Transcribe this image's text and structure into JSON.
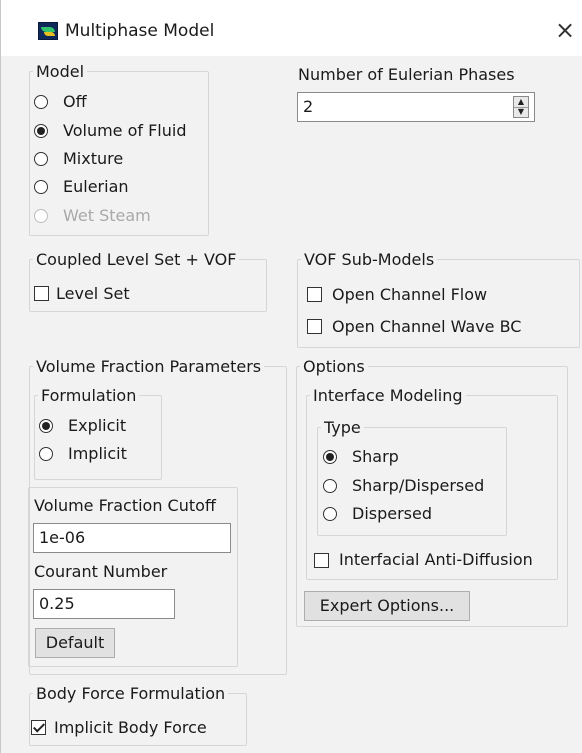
{
  "window": {
    "title": "Multiphase Model",
    "close_glyph": "×",
    "icon": "fluent-app-icon"
  },
  "model": {
    "legend": "Model",
    "options": [
      {
        "label": "Off",
        "selected": false,
        "enabled": true
      },
      {
        "label": "Volume of Fluid",
        "selected": true,
        "enabled": true
      },
      {
        "label": "Mixture",
        "selected": false,
        "enabled": true
      },
      {
        "label": "Eulerian",
        "selected": false,
        "enabled": true
      },
      {
        "label": "Wet Steam",
        "selected": false,
        "enabled": false
      }
    ]
  },
  "eulerian_phases": {
    "label": "Number of Eulerian Phases",
    "value": "2"
  },
  "coupled": {
    "legend": "Coupled Level Set + VOF",
    "level_set": {
      "label": "Level Set",
      "checked": false
    }
  },
  "vof_submodels": {
    "legend": "VOF Sub-Models",
    "open_channel_flow": {
      "label": "Open Channel Flow",
      "checked": false
    },
    "open_channel_wave_bc": {
      "label": "Open Channel Wave BC",
      "checked": false
    }
  },
  "vf_params": {
    "legend": "Volume Fraction Parameters",
    "formulation": {
      "legend": "Formulation",
      "explicit": {
        "label": "Explicit",
        "selected": true
      },
      "implicit": {
        "label": "Implicit",
        "selected": false
      }
    },
    "cutoff": {
      "label": "Volume Fraction Cutoff",
      "value": "1e-06"
    },
    "courant": {
      "label": "Courant Number",
      "value": "0.25"
    },
    "default_button": "Default"
  },
  "options": {
    "legend": "Options",
    "interface": {
      "legend": "Interface Modeling",
      "type": {
        "legend": "Type",
        "sharp": {
          "label": "Sharp",
          "selected": true
        },
        "sharp_dispersed": {
          "label": "Sharp/Dispersed",
          "selected": false
        },
        "dispersed": {
          "label": "Dispersed",
          "selected": false
        }
      },
      "anti_diffusion": {
        "label": "Interfacial Anti-Diffusion",
        "checked": false
      }
    },
    "expert_button": "Expert Options..."
  },
  "body_force": {
    "legend": "Body Force Formulation",
    "implicit": {
      "label": "Implicit Body Force",
      "checked": true
    }
  }
}
